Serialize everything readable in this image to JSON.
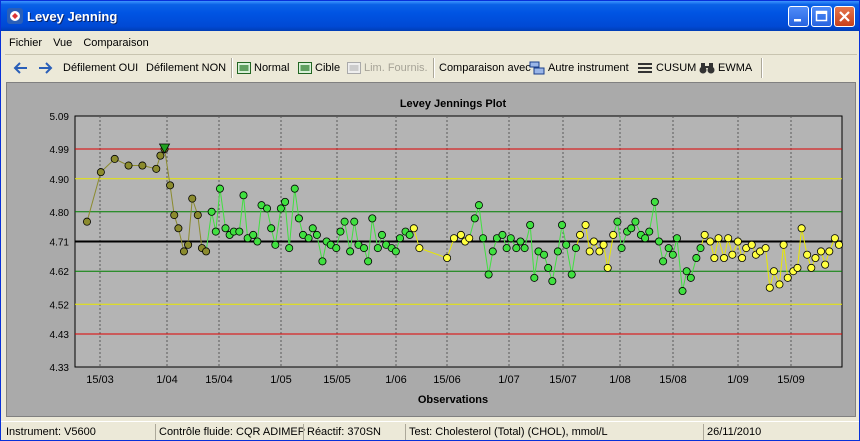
{
  "window": {
    "title": "Levey Jenning"
  },
  "menu": [
    "Fichier",
    "Vue",
    "Comparaison"
  ],
  "toolbar": {
    "scroll_on": "Défilement OUI",
    "scroll_off": "Défilement NON",
    "normal": "Normal",
    "target": "Cible",
    "supplier_limits": "Lim. Fournis.",
    "compare_with": "Comparaison avec",
    "other_instrument": "Autre instrument",
    "cusum": "CUSUM",
    "ewma": "EWMA"
  },
  "status": {
    "instrument": "Instrument: V5600",
    "control": "Contrôle fluide: CQR ADIMEP",
    "reagent": "Réactif: 370SN",
    "test": "Test: Cholesterol (Total) (CHOL), mmol/L",
    "date": "26/11/2010"
  },
  "chart_data": {
    "type": "line",
    "title": "Levey Jennings Plot",
    "xlabel": "Observations",
    "ylabel": "",
    "ylim": [
      4.33,
      5.09
    ],
    "y_ticks": [
      "5.09",
      "4.99",
      "4.90",
      "4.80",
      "4.71",
      "4.62",
      "4.52",
      "4.43",
      "4.33"
    ],
    "x_ticks": [
      "15/03",
      "1/04",
      "15/04",
      "1/05",
      "15/05",
      "1/06",
      "15/06",
      "1/07",
      "15/07",
      "1/08",
      "15/08",
      "1/09",
      "15/09"
    ],
    "reference_lines": [
      {
        "y": 4.99,
        "color": "#e00000"
      },
      {
        "y": 4.9,
        "color": "#e8e800"
      },
      {
        "y": 4.8,
        "color": "#008000"
      },
      {
        "y": 4.71,
        "color": "#000000"
      },
      {
        "y": 4.62,
        "color": "#008000"
      },
      {
        "y": 4.52,
        "color": "#e8e800"
      },
      {
        "y": 4.43,
        "color": "#e00000"
      }
    ],
    "series": [
      {
        "color": "#8b8b2e",
        "marker": "#8b8b2e",
        "values": [
          [
            0,
            4.77
          ],
          [
            1,
            4.92
          ],
          [
            2,
            4.96
          ],
          [
            3,
            4.94
          ],
          [
            4,
            4.94
          ],
          [
            5,
            4.93
          ],
          [
            5.3,
            4.97
          ],
          [
            5.6,
            4.99
          ],
          [
            6,
            4.88
          ],
          [
            6.3,
            4.79
          ],
          [
            6.6,
            4.75
          ],
          [
            7,
            4.68
          ],
          [
            7.3,
            4.7
          ],
          [
            7.6,
            4.84
          ],
          [
            8,
            4.79
          ],
          [
            8.3,
            4.69
          ],
          [
            8.6,
            4.68
          ]
        ]
      },
      {
        "color": "#40e040",
        "marker": "#40e040",
        "values": [
          [
            9,
            4.8
          ],
          [
            9.3,
            4.74
          ],
          [
            9.6,
            4.87
          ],
          [
            10,
            4.75
          ],
          [
            10.3,
            4.73
          ],
          [
            10.6,
            4.74
          ],
          [
            11,
            4.74
          ],
          [
            11.3,
            4.85
          ],
          [
            11.6,
            4.72
          ],
          [
            12,
            4.73
          ],
          [
            12.3,
            4.71
          ],
          [
            12.6,
            4.82
          ],
          [
            13,
            4.81
          ],
          [
            13.3,
            4.75
          ],
          [
            13.6,
            4.7
          ],
          [
            14,
            4.81
          ],
          [
            14.3,
            4.83
          ],
          [
            14.6,
            4.69
          ],
          [
            15,
            4.87
          ],
          [
            15.3,
            4.78
          ],
          [
            15.6,
            4.73
          ],
          [
            16,
            4.72
          ],
          [
            16.3,
            4.75
          ],
          [
            16.6,
            4.73
          ],
          [
            17,
            4.65
          ],
          [
            17.3,
            4.71
          ],
          [
            17.6,
            4.7
          ],
          [
            18,
            4.69
          ],
          [
            18.3,
            4.74
          ],
          [
            18.6,
            4.77
          ],
          [
            19,
            4.68
          ],
          [
            19.3,
            4.77
          ],
          [
            19.6,
            4.7
          ],
          [
            20,
            4.69
          ],
          [
            20.3,
            4.65
          ],
          [
            20.6,
            4.78
          ],
          [
            21,
            4.69
          ],
          [
            21.3,
            4.73
          ],
          [
            21.6,
            4.7
          ],
          [
            22,
            4.69
          ],
          [
            22.3,
            4.68
          ],
          [
            22.6,
            4.72
          ],
          [
            23,
            4.74
          ],
          [
            23.3,
            4.73
          ]
        ]
      },
      {
        "color": "#e8e800",
        "marker": "#ffff40",
        "values": [
          [
            23.6,
            4.75
          ],
          [
            24,
            4.69
          ],
          [
            26,
            4.66
          ],
          [
            26.5,
            4.72
          ],
          [
            27,
            4.73
          ],
          [
            27.3,
            4.71
          ],
          [
            27.6,
            4.72
          ]
        ]
      },
      {
        "color": "#40e040",
        "marker": "#40e040",
        "values": [
          [
            28,
            4.78
          ],
          [
            28.3,
            4.82
          ],
          [
            28.6,
            4.72
          ],
          [
            29,
            4.61
          ],
          [
            29.3,
            4.68
          ],
          [
            29.6,
            4.72
          ],
          [
            30,
            4.73
          ],
          [
            30.3,
            4.69
          ],
          [
            30.6,
            4.72
          ],
          [
            31,
            4.69
          ],
          [
            31.3,
            4.71
          ],
          [
            31.6,
            4.69
          ],
          [
            32,
            4.76
          ],
          [
            32.3,
            4.6
          ],
          [
            32.6,
            4.68
          ],
          [
            33,
            4.67
          ],
          [
            33.3,
            4.63
          ],
          [
            33.6,
            4.59
          ],
          [
            34,
            4.68
          ],
          [
            34.3,
            4.76
          ],
          [
            34.6,
            4.7
          ],
          [
            35,
            4.61
          ],
          [
            35.3,
            4.69
          ]
        ]
      },
      {
        "color": "#e8e800",
        "marker": "#ffff40",
        "values": [
          [
            35.6,
            4.73
          ],
          [
            36,
            4.76
          ],
          [
            36.3,
            4.68
          ],
          [
            36.6,
            4.71
          ],
          [
            37,
            4.68
          ],
          [
            37.3,
            4.7
          ],
          [
            37.6,
            4.63
          ],
          [
            38,
            4.73
          ]
        ]
      },
      {
        "color": "#40e040",
        "marker": "#40e040",
        "values": [
          [
            38.3,
            4.77
          ],
          [
            38.6,
            4.69
          ],
          [
            39,
            4.74
          ],
          [
            39.3,
            4.75
          ],
          [
            39.6,
            4.77
          ],
          [
            40,
            4.73
          ],
          [
            40.3,
            4.72
          ],
          [
            40.6,
            4.74
          ],
          [
            41,
            4.83
          ],
          [
            41.3,
            4.71
          ],
          [
            41.6,
            4.65
          ],
          [
            42,
            4.69
          ],
          [
            42.3,
            4.67
          ],
          [
            42.6,
            4.72
          ],
          [
            43,
            4.56
          ],
          [
            43.3,
            4.62
          ],
          [
            43.6,
            4.6
          ],
          [
            44,
            4.66
          ],
          [
            44.3,
            4.69
          ]
        ]
      },
      {
        "color": "#e8e800",
        "marker": "#ffff40",
        "values": [
          [
            44.6,
            4.73
          ],
          [
            45,
            4.71
          ],
          [
            45.3,
            4.66
          ],
          [
            45.6,
            4.72
          ],
          [
            46,
            4.66
          ],
          [
            46.3,
            4.72
          ],
          [
            46.6,
            4.67
          ],
          [
            47,
            4.71
          ],
          [
            47.3,
            4.66
          ],
          [
            47.6,
            4.69
          ],
          [
            48,
            4.7
          ],
          [
            48.3,
            4.67
          ],
          [
            48.6,
            4.68
          ],
          [
            49,
            4.69
          ],
          [
            49.3,
            4.57
          ],
          [
            49.6,
            4.62
          ],
          [
            50,
            4.58
          ],
          [
            50.3,
            4.7
          ],
          [
            50.6,
            4.6
          ],
          [
            51,
            4.62
          ],
          [
            51.3,
            4.63
          ],
          [
            51.6,
            4.75
          ],
          [
            52,
            4.67
          ],
          [
            52.3,
            4.63
          ],
          [
            52.6,
            4.66
          ],
          [
            53,
            4.68
          ],
          [
            53.3,
            4.64
          ],
          [
            53.6,
            4.68
          ],
          [
            54,
            4.72
          ],
          [
            54.3,
            4.7
          ]
        ]
      }
    ],
    "inverted_triangle_marker": {
      "x": 5.6,
      "y": 4.99,
      "color": "#20a020"
    },
    "x_range": [
      0,
      54.3
    ]
  }
}
